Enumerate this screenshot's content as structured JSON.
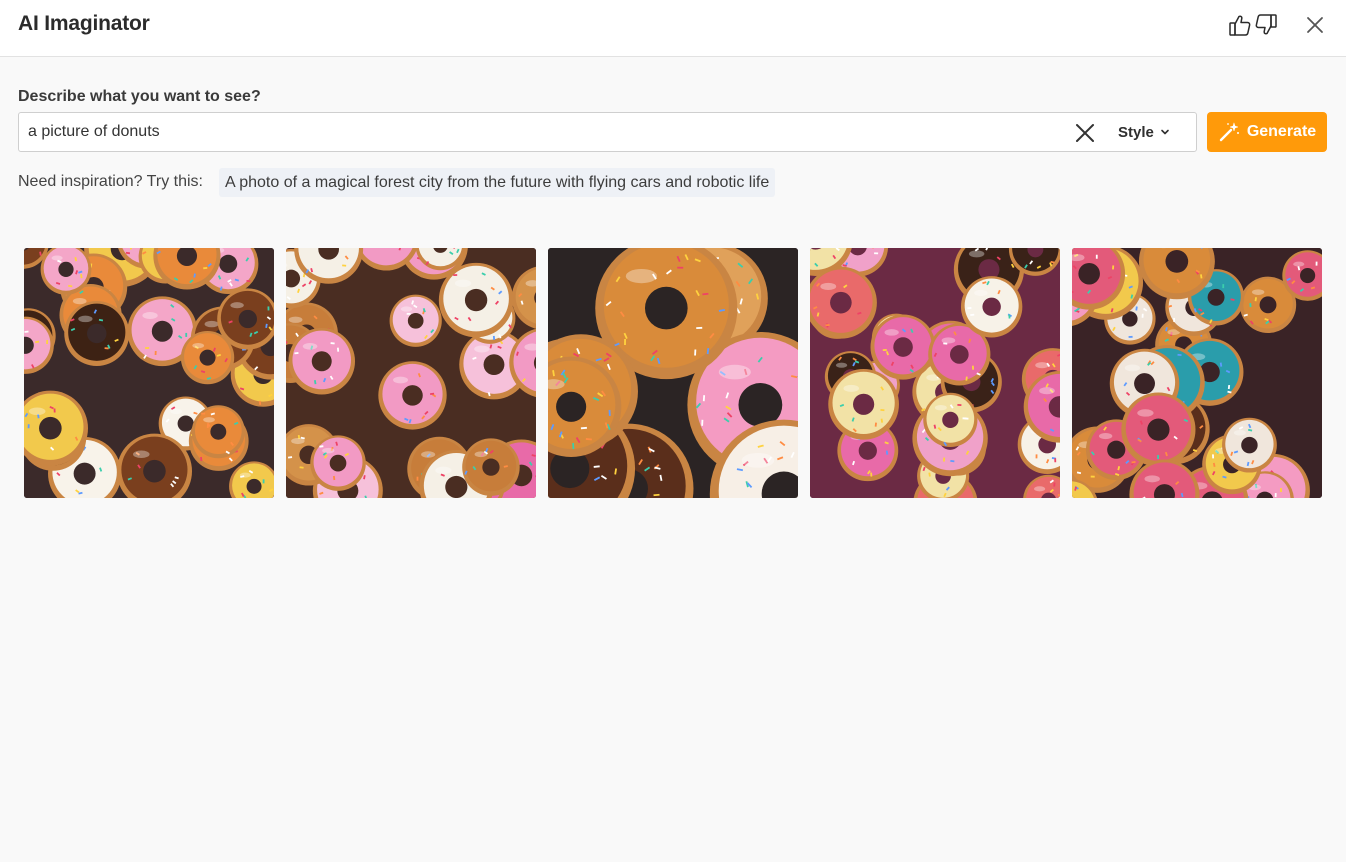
{
  "header": {
    "title": "AI Imaginator",
    "icons": [
      "thumbs-up-icon",
      "thumbs-down-icon",
      "close-icon"
    ]
  },
  "prompt": {
    "label": "Describe what you want to see?",
    "value": "a picture of donuts",
    "clear_icon": "close-icon",
    "style_label": "Style",
    "style_icon": "chevron-down-icon"
  },
  "generate": {
    "label": "Generate",
    "icon": "magic-wand-icon",
    "color": "#ff9a0a"
  },
  "inspiration": {
    "label": "Need inspiration? Try this:",
    "suggestion": "A photo of a magical forest city from the future with flying cars and robotic life"
  },
  "results": {
    "images": [
      {
        "subject": "donuts",
        "bg": "#3b2a2a",
        "palette": [
          "#f4a6c8",
          "#7a3f1e",
          "#f2c94c",
          "#e98a3a",
          "#2a9d8f",
          "#3d2214",
          "#f8f3ea"
        ]
      },
      {
        "subject": "donuts",
        "bg": "#4a2d22",
        "palette": [
          "#f29ac4",
          "#f6c1da",
          "#d4924a",
          "#f5f0e6",
          "#c77d3a",
          "#e86aa8"
        ]
      },
      {
        "subject": "donuts",
        "bg": "#2b2424",
        "palette": [
          "#f49bc2",
          "#e0a15a",
          "#f7efe6",
          "#5a2e1b",
          "#d98b3a"
        ]
      },
      {
        "subject": "donuts",
        "bg": "#6b2a44",
        "palette": [
          "#f0a1c9",
          "#f2e2a6",
          "#3a2218",
          "#e96a6a",
          "#f7f2e8",
          "#e86aa8"
        ]
      },
      {
        "subject": "donuts",
        "bg": "#3a2326",
        "palette": [
          "#f49bc2",
          "#2a9dab",
          "#d98b3a",
          "#5a2e1b",
          "#f2c94c",
          "#e35a7a",
          "#f0e6dc"
        ]
      }
    ]
  }
}
